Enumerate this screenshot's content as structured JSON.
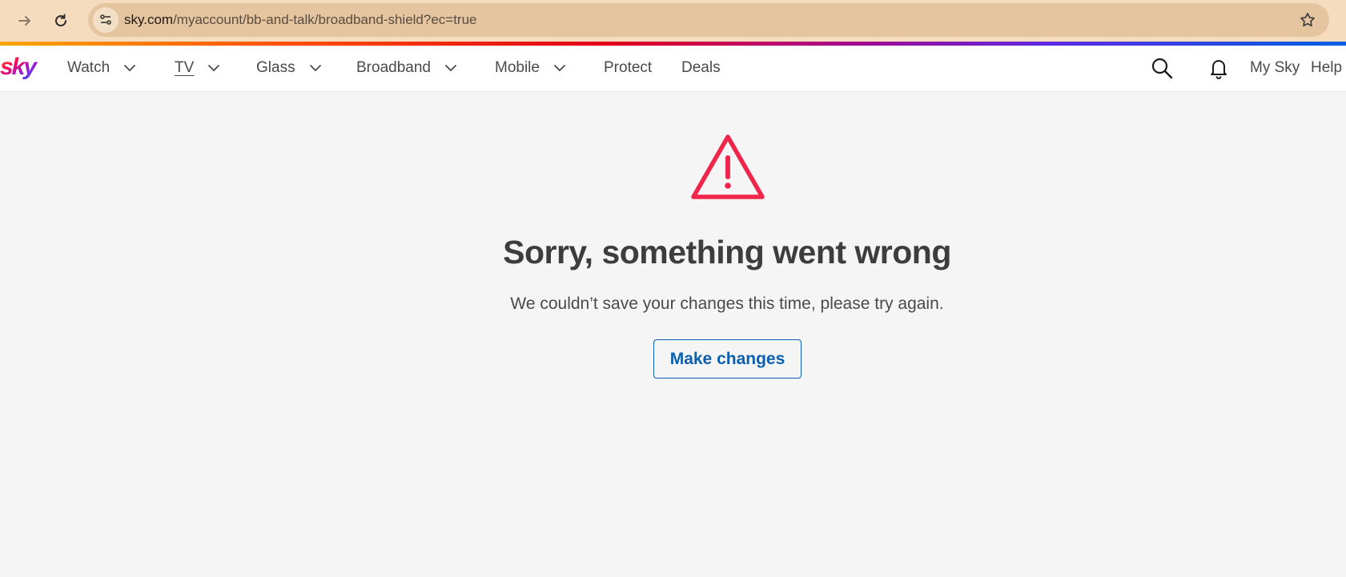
{
  "browser": {
    "url_host": "sky.com",
    "url_path": "/myaccount/bb-and-talk/broadband-shield?ec=true",
    "icons": [
      "forward-icon",
      "reload-icon",
      "site-info-icon",
      "bookmark-star-icon"
    ]
  },
  "header": {
    "logo": "sky",
    "nav": [
      {
        "label": "Watch",
        "has_dropdown": true
      },
      {
        "label": "TV",
        "has_dropdown": true
      },
      {
        "label": "Glass",
        "has_dropdown": true
      },
      {
        "label": "Broadband",
        "has_dropdown": true
      },
      {
        "label": "Mobile",
        "has_dropdown": true
      },
      {
        "label": "Protect",
        "has_dropdown": false
      },
      {
        "label": "Deals",
        "has_dropdown": false
      }
    ],
    "my_sky": "My Sky",
    "help": "Help",
    "icons": [
      "search-icon",
      "bell-icon"
    ]
  },
  "error": {
    "icon": "warning-icon",
    "title": "Sorry, something went wrong",
    "message": "We couldn’t save your changes this time, please try again.",
    "button_label": "Make changes"
  },
  "colors": {
    "warning": "#f0254a",
    "link_blue": "#0b5fb0",
    "browser_bar": "#f6dcbf"
  }
}
